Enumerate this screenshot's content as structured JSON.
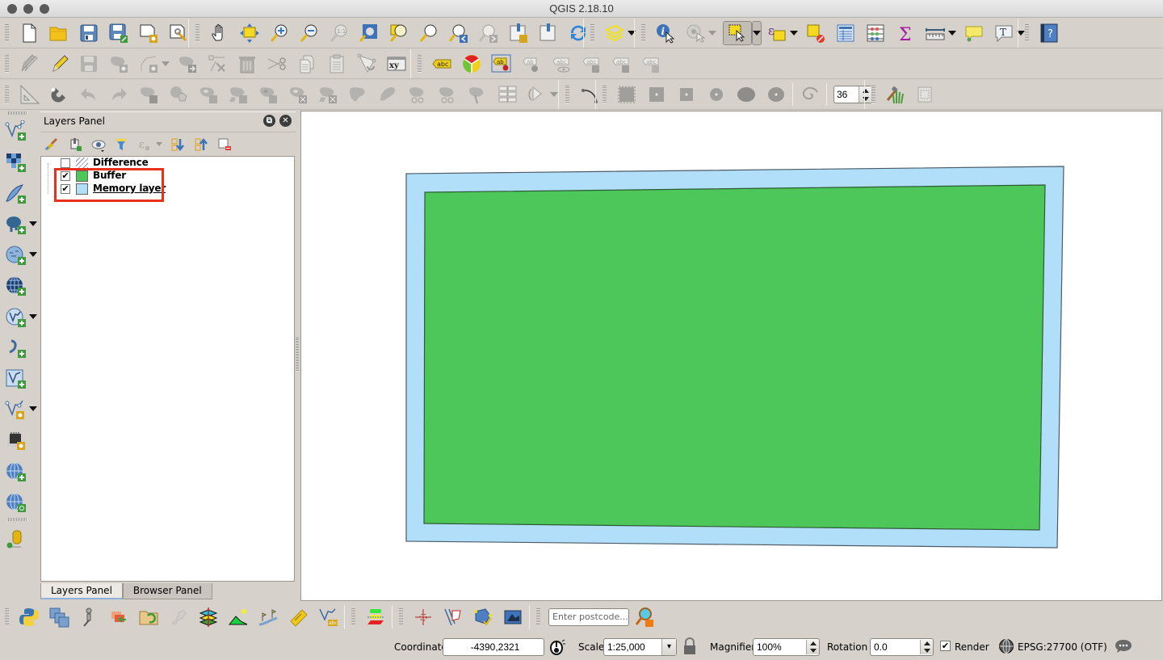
{
  "window": {
    "title": "QGIS 2.18.10"
  },
  "toolbars": {
    "file": [
      "new-project",
      "open-project",
      "save-project",
      "save-project-as",
      "new-print-composer",
      "composer-manager"
    ],
    "navigation": [
      "pan",
      "pan-to-selection",
      "zoom-in",
      "zoom-out",
      "zoom-native",
      "zoom-full",
      "zoom-to-selection",
      "zoom-to-layer",
      "zoom-last",
      "zoom-next",
      "new-bookmark",
      "show-bookmarks",
      "refresh"
    ],
    "layer_style": [
      "layer-style-manager"
    ],
    "attributes": [
      "identify",
      "run-action",
      "select-features",
      "select-by-expression",
      "deselect-all",
      "attribute-table",
      "field-calculator",
      "statistical-summary",
      "measure",
      "map-tips",
      "text-annotation"
    ],
    "help": [
      "help"
    ],
    "digitizing": [
      "current-edits",
      "toggle-editing",
      "save-layer-edits",
      "add-feature",
      "vertex-tool-add",
      "move-feature",
      "node-tool",
      "delete-selected",
      "cut-features",
      "copy-features",
      "paste-features",
      "reshape",
      "xy-coordinate"
    ],
    "label": [
      "layer-labeling",
      "diagram",
      "pin-labels",
      "show-hide-labels",
      "preview-labels",
      "move-label",
      "rotate-label",
      "change-label"
    ],
    "advanced_digitizing": [
      "enable-advanced-digitizing",
      "enable-snapping",
      "undo",
      "redo",
      "rotate-feature",
      "simplify",
      "add-ring",
      "add-part",
      "fill-ring",
      "delete-ring",
      "delete-part",
      "reshape-features",
      "offset-curve",
      "split-features",
      "split-parts",
      "merge-features",
      "merge-attributes",
      "rotate-point-symbols"
    ],
    "shape_digitizing": [
      "add-circular-string",
      "rectangle-extent",
      "rectangle-center",
      "square-center",
      "circle-center",
      "ellipse-extent",
      "ellipse-center",
      "regular-polygon"
    ],
    "segments": {
      "label": "36"
    }
  },
  "layers_panel": {
    "title": "Layers Panel",
    "tools": [
      "open-layer-styling",
      "add-group",
      "manage-visibility",
      "filter-legend",
      "filter-expression",
      "expand-all",
      "collapse-all",
      "remove-layer"
    ],
    "layers": [
      {
        "name": "Difference",
        "checked": false,
        "swatch": "hatch"
      },
      {
        "name": "Buffer",
        "checked": true,
        "swatch": "#4dc75a"
      },
      {
        "name": "Memory layer",
        "checked": true,
        "swatch": "#b1dffa",
        "underline": true
      }
    ],
    "check_mark": "✔"
  },
  "panel_tabs": [
    {
      "label": "Layers Panel",
      "active": true
    },
    {
      "label": "Browser Panel",
      "active": false
    }
  ],
  "map": {
    "layers": [
      {
        "name": "Memory layer",
        "fill": "#b1dffa",
        "stroke": "#4c5a66"
      },
      {
        "name": "Buffer",
        "fill": "#4dc75a",
        "stroke": "#2e5a34"
      }
    ]
  },
  "plugins_toolbar": {
    "postcode_placeholder": "Enter postcode..."
  },
  "status": {
    "coordinate_label": "Coordinate",
    "coordinate_value": "-4390,2321",
    "scale_label": "Scale",
    "scale_value": "1:25,000",
    "magnifier_label": "Magnifier",
    "magnifier_value": "100%",
    "rotation_label": "Rotation",
    "rotation_value": "0.0",
    "render_label": "Render",
    "render_checked": true,
    "crs_label": "EPSG:27700 (OTF)"
  },
  "colors": {
    "highlight_box": "#e8301c",
    "buffer_fill": "#4dc75a",
    "memory_fill": "#b1dffa"
  }
}
